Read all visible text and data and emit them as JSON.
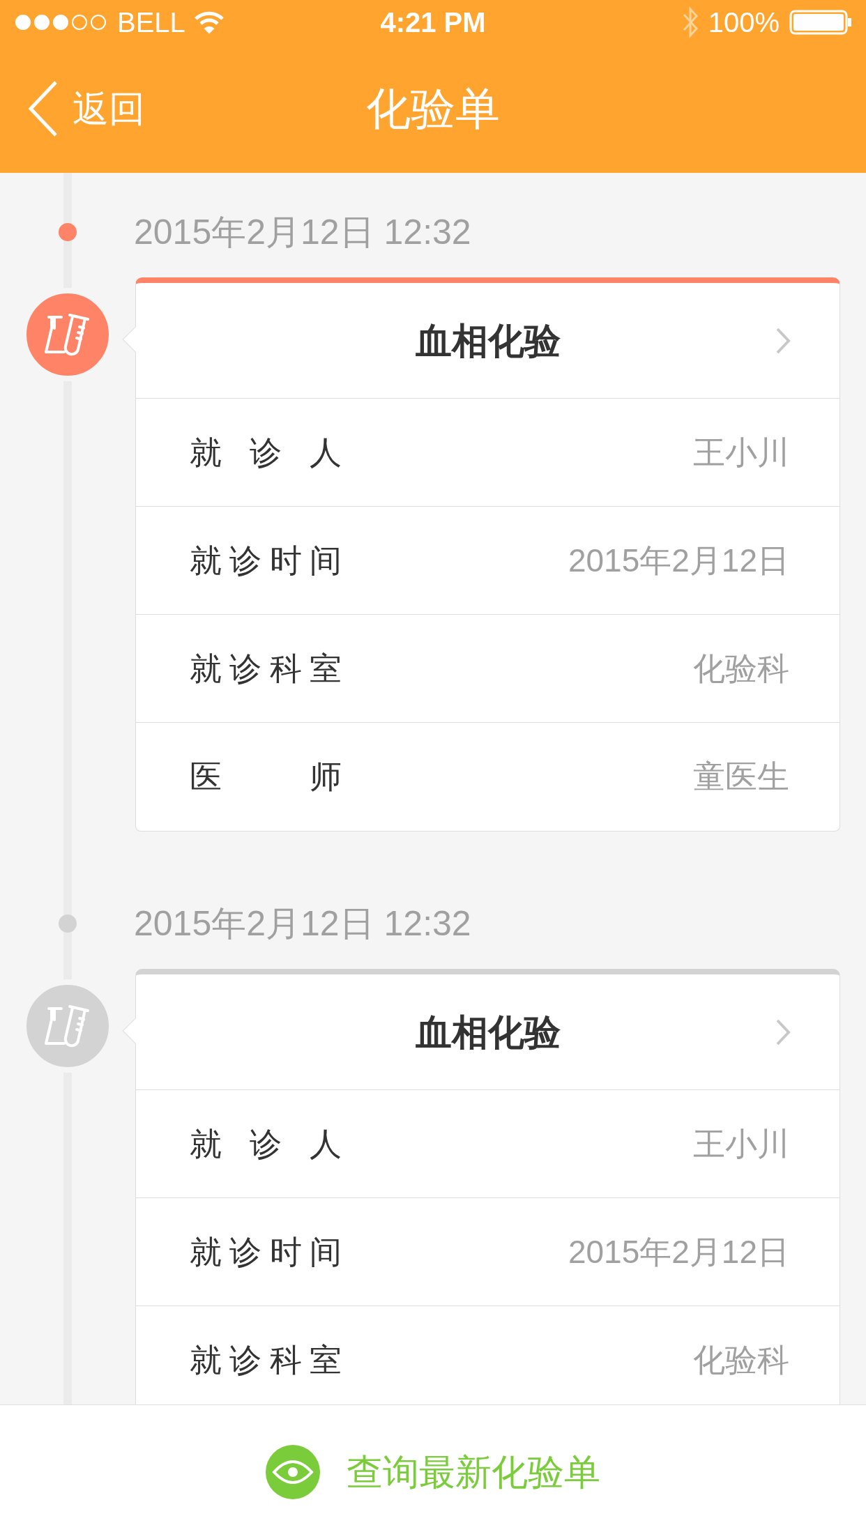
{
  "status_bar": {
    "carrier": "BELL",
    "time": "4:21 PM",
    "battery": "100%"
  },
  "nav": {
    "back": "返回",
    "title": "化验单"
  },
  "entries": [
    {
      "date": "2015年2月12日 12:32",
      "active": true,
      "title": "血相化验",
      "rows": [
        {
          "label": "就 诊 人",
          "value": "王小川"
        },
        {
          "label": "就诊时间",
          "value": "2015年2月12日"
        },
        {
          "label": "就诊科室",
          "value": "化验科"
        },
        {
          "label": "医　　师",
          "value": "童医生"
        }
      ]
    },
    {
      "date": "2015年2月12日 12:32",
      "active": false,
      "title": "血相化验",
      "rows": [
        {
          "label": "就 诊 人",
          "value": "王小川"
        },
        {
          "label": "就诊时间",
          "value": "2015年2月12日"
        },
        {
          "label": "就诊科室",
          "value": "化验科"
        }
      ]
    }
  ],
  "bottom_button": "查询最新化验单"
}
